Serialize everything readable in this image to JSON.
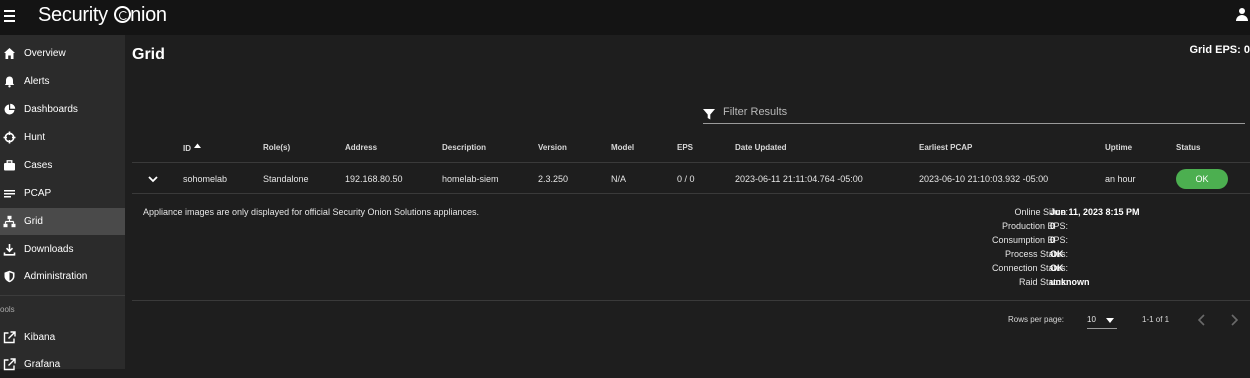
{
  "app": {
    "brand_prefix": "Security",
    "brand_suffix": "nion"
  },
  "sidebar": {
    "items": [
      {
        "label": "Overview",
        "icon": "home-icon"
      },
      {
        "label": "Alerts",
        "icon": "bell-icon"
      },
      {
        "label": "Dashboards",
        "icon": "pie-chart-icon"
      },
      {
        "label": "Hunt",
        "icon": "crosshair-icon"
      },
      {
        "label": "Cases",
        "icon": "briefcase-icon"
      },
      {
        "label": "PCAP",
        "icon": "list-icon"
      },
      {
        "label": "Grid",
        "icon": "network-icon"
      },
      {
        "label": "Downloads",
        "icon": "download-icon"
      },
      {
        "label": "Administration",
        "icon": "shield-icon"
      }
    ],
    "tools_header": "ools",
    "tools": [
      {
        "label": "Kibana",
        "icon": "external-link-icon"
      },
      {
        "label": "Grafana",
        "icon": "external-link-icon"
      }
    ],
    "active": "Grid"
  },
  "page": {
    "title": "Grid",
    "grid_eps": "Grid EPS: 0"
  },
  "filter": {
    "placeholder": "Filter Results",
    "value": ""
  },
  "table": {
    "headers": [
      "ID",
      "Role(s)",
      "Address",
      "Description",
      "Version",
      "Model",
      "EPS",
      "Date Updated",
      "Earliest PCAP",
      "Uptime",
      "Status"
    ],
    "sort_column": "ID",
    "sort_direction": "ascending",
    "rows": [
      {
        "id": "sohomelab",
        "roles": "Standalone",
        "address": "192.168.80.50",
        "description": "homelab-siem",
        "version": "2.3.250",
        "model": "N/A",
        "eps": "0 / 0",
        "date_updated": "2023-06-11 21:11:04.764 -05:00",
        "earliest_pcap": "2023-06-10 21:10:03.932 -05:00",
        "uptime": "an hour",
        "status": "OK"
      }
    ],
    "detail": {
      "note": "Appliance images are only displayed for official Security Onion Solutions appliances.",
      "fields": [
        {
          "label": "Online Since:",
          "value": "Jun 11, 2023 8:15 PM"
        },
        {
          "label": "Production EPS:",
          "value": "0"
        },
        {
          "label": "Consumption EPS:",
          "value": "0"
        },
        {
          "label": "Process Status:",
          "value": "OK"
        },
        {
          "label": "Connection Status:",
          "value": "OK"
        },
        {
          "label": "Raid Status:",
          "value": "unknown"
        }
      ]
    }
  },
  "pagination": {
    "rows_per_page_label": "Rows per page:",
    "rows_per_page": "10",
    "range": "1-1 of 1"
  },
  "colors": {
    "ok_green": "#4caf50",
    "active_nav": "#4a4a4a",
    "sidebar_bg": "#2b2b2b",
    "topbar_bg": "#141414"
  }
}
